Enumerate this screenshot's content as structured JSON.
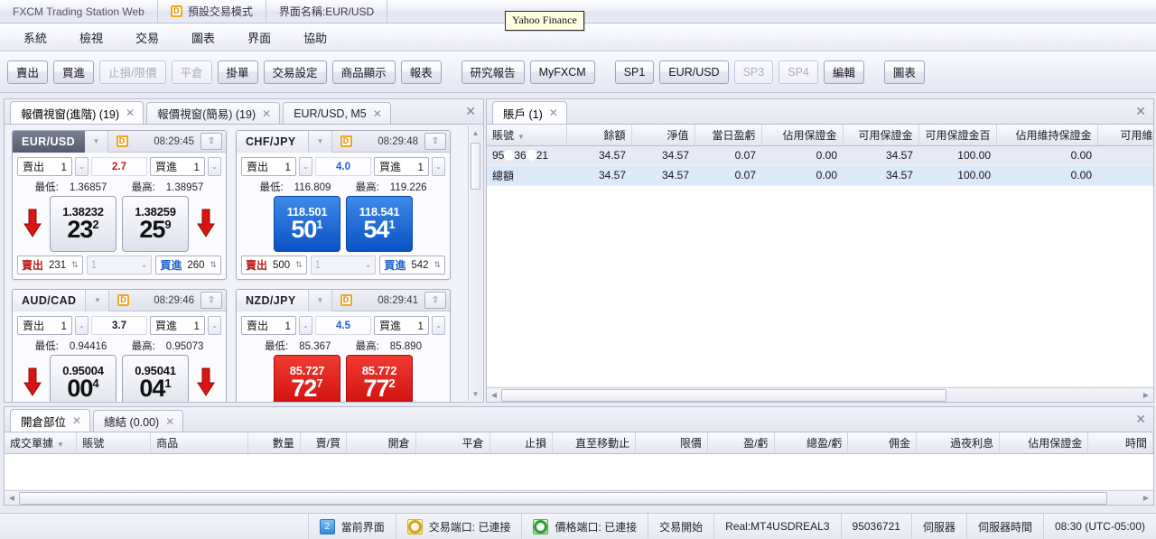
{
  "titlebar": {
    "app_name": "FXCM Trading Station Web",
    "mode_badge": "D",
    "mode_label": "預設交易模式",
    "layout_label": "界面名稱:EUR/USD"
  },
  "tooltip": {
    "text": "Yahoo Finance"
  },
  "menubar": {
    "items": [
      {
        "label": "系統"
      },
      {
        "label": "檢視"
      },
      {
        "label": "交易"
      },
      {
        "label": "圖表"
      },
      {
        "label": "界面"
      },
      {
        "label": "協助"
      }
    ]
  },
  "toolbar": {
    "buttons": [
      {
        "label": "賣出",
        "disabled": false
      },
      {
        "label": "買進",
        "disabled": false
      },
      {
        "label": "止損/限價",
        "disabled": true
      },
      {
        "label": "平倉",
        "disabled": true
      },
      {
        "label": "掛單",
        "disabled": false
      },
      {
        "label": "交易設定",
        "disabled": false
      },
      {
        "label": "商品顯示",
        "disabled": false
      },
      {
        "label": "報表",
        "disabled": false
      }
    ],
    "buttons2": [
      {
        "label": "研究報告",
        "disabled": false
      },
      {
        "label": "MyFXCM",
        "disabled": false
      }
    ],
    "buttons3": [
      {
        "label": "SP1",
        "disabled": false
      },
      {
        "label": "EUR/USD",
        "disabled": false
      },
      {
        "label": "SP3",
        "disabled": true
      },
      {
        "label": "SP4",
        "disabled": true
      },
      {
        "label": "編輯",
        "disabled": false
      }
    ],
    "buttons4": [
      {
        "label": "圖表",
        "disabled": false
      }
    ]
  },
  "quote_panel": {
    "tabs": [
      {
        "label": "報價視窗(進階) (19)",
        "active": true
      },
      {
        "label": "報價視窗(簡易) (19)",
        "active": false
      },
      {
        "label": "EUR/USD, M5",
        "active": false
      }
    ],
    "close_glyph": "✕",
    "labels": {
      "sell": "賣出",
      "buy": "買進",
      "low_prefix": "最低:",
      "high_prefix": "最高:",
      "mode_badge": "D"
    },
    "quotes": [
      {
        "symbol": "EUR/USD",
        "symbol_dark": true,
        "time": "08:29:45",
        "sell_amount": "1",
        "buy_amount": "1",
        "spread": "2.7",
        "spread_color": "red",
        "low": "1.36857",
        "high": "1.38957",
        "direction": "down",
        "bid_full": "1.38232",
        "bid_big": "23",
        "bid_sup": "2",
        "ask_full": "1.38259",
        "ask_big": "25",
        "ask_sup": "9",
        "box_style": "grey",
        "sell_lot": "231",
        "mid_lot": "1",
        "buy_lot": "260"
      },
      {
        "symbol": "CHF/JPY",
        "symbol_dark": false,
        "time": "08:29:48",
        "sell_amount": "1",
        "buy_amount": "1",
        "spread": "4.0",
        "spread_color": "blue",
        "low": "116.809",
        "high": "119.226",
        "direction": "none",
        "bid_full": "118.501",
        "bid_big": "50",
        "bid_sup": "1",
        "ask_full": "118.541",
        "ask_big": "54",
        "ask_sup": "1",
        "box_style": "blue",
        "sell_lot": "500",
        "mid_lot": "1",
        "buy_lot": "542"
      },
      {
        "symbol": "AUD/CAD",
        "symbol_dark": false,
        "time": "08:29:46",
        "sell_amount": "1",
        "buy_amount": "1",
        "spread": "3.7",
        "spread_color": "dark",
        "low": "0.94416",
        "high": "0.95073",
        "direction": "down",
        "bid_full": "0.95004",
        "bid_big": "00",
        "bid_sup": "4",
        "ask_full": "0.95041",
        "ask_big": "04",
        "ask_sup": "1",
        "box_style": "grey",
        "sell_lot": "",
        "mid_lot": "",
        "buy_lot": ""
      },
      {
        "symbol": "NZD/JPY",
        "symbol_dark": false,
        "time": "08:29:41",
        "sell_amount": "1",
        "buy_amount": "1",
        "spread": "4.5",
        "spread_color": "blue",
        "low": "85.367",
        "high": "85.890",
        "direction": "none",
        "bid_full": "85.727",
        "bid_big": "72",
        "bid_sup": "7",
        "ask_full": "85.772",
        "ask_big": "77",
        "ask_sup": "2",
        "box_style": "red",
        "sell_lot": "",
        "mid_lot": "",
        "buy_lot": ""
      }
    ]
  },
  "account_panel": {
    "tabs": [
      {
        "label": "賬戶 (1)",
        "active": true
      }
    ],
    "close_glyph": "✕",
    "columns": [
      "賬號",
      "餘額",
      "淨值",
      "當日盈虧",
      "佔用保證金",
      "可用保證金",
      "可用保證金百",
      "佔用維持保證金",
      "可用維持"
    ],
    "rows": [
      {
        "account": "95 36 21",
        "balance": "34.57",
        "equity": "34.57",
        "day_pl": "0.07",
        "used_margin": "0.00",
        "usable_margin": "34.57",
        "usable_margin_pct": "100.00",
        "used_maint": "0.00",
        "usable_maint": ""
      }
    ],
    "total_row": {
      "account": "總額",
      "balance": "34.57",
      "equity": "34.57",
      "day_pl": "0.07",
      "used_margin": "0.00",
      "usable_margin": "34.57",
      "usable_margin_pct": "100.00",
      "used_maint": "0.00",
      "usable_maint": ""
    }
  },
  "orders_panel": {
    "tabs": [
      {
        "label": "開倉部位",
        "active": true
      },
      {
        "label": "總結 (0.00)",
        "active": false
      }
    ],
    "close_glyph": "✕",
    "columns": [
      "成交單據",
      "賬號",
      "商品",
      "數量",
      "賣/買",
      "開倉",
      "平倉",
      "止損",
      "直至移動止",
      "限價",
      "盈/虧",
      "總盈/虧",
      "佣金",
      "過夜利息",
      "佔用保證金",
      "時間"
    ],
    "rows": []
  },
  "statusbar": {
    "workspace_number": "2",
    "workspace_label": "當前界面",
    "trade_port_label": "交易端口: 已連接",
    "price_port_label": "價格端口: 已連接",
    "trading_state": "交易開始",
    "account_type": "Real:MT4USDREAL3",
    "account_id": "95036721",
    "server_label": "伺服器",
    "server_time_label": "伺服器時間",
    "server_time": "08:30 (UTC-05:00)"
  }
}
